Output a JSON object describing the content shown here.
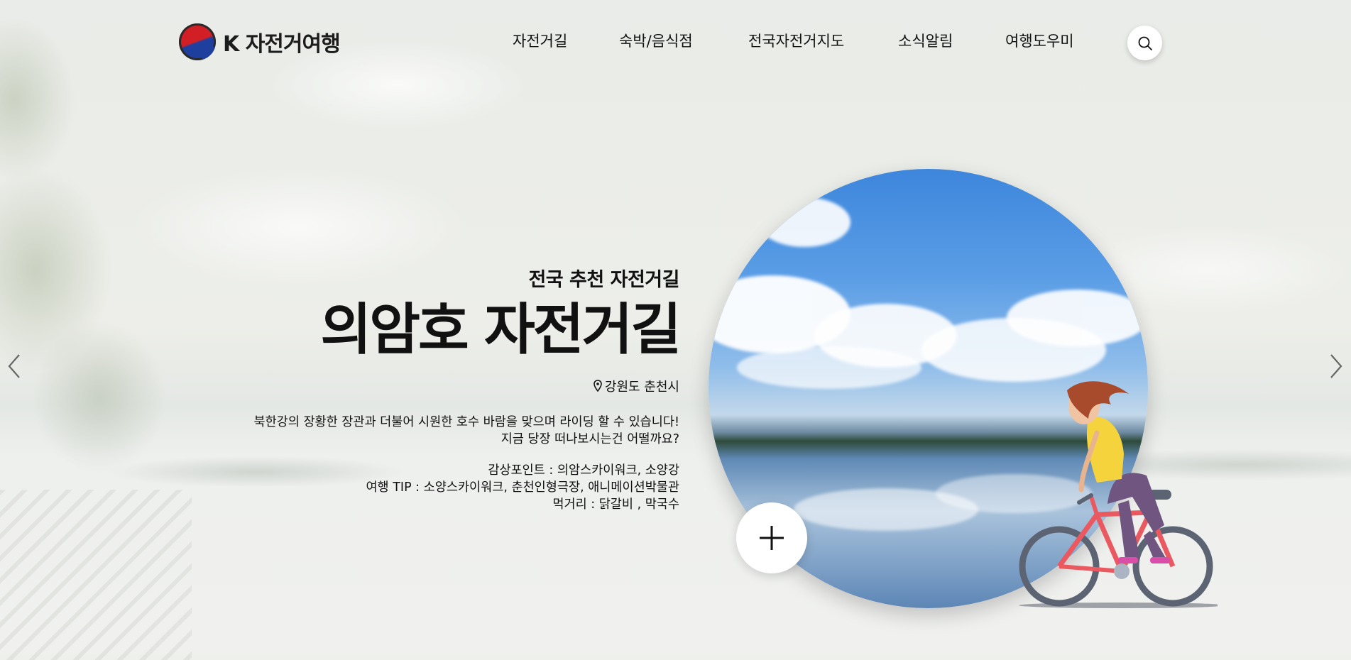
{
  "brand": {
    "logo_text": "K 자전거여행"
  },
  "nav": [
    {
      "label": "자전거길"
    },
    {
      "label": "숙박/음식점"
    },
    {
      "label": "전국자전거지도"
    },
    {
      "label": "소식알림"
    },
    {
      "label": "여행도우미"
    }
  ],
  "hero": {
    "eyebrow": "전국 추천 자전거길",
    "title": "의암호 자전거길",
    "location": "강원도 춘천시",
    "description": [
      "북한강의 장황한 장관과 더불어 시원한 호수 바람을 맞으며 라이딩 할 수 있습니다!",
      "지금 당장 떠나보시는건 어떨까요?"
    ],
    "info": [
      "감상포인트 : 의암스카이워크, 소양강",
      "여행 TIP : 소양스카이워크, 춘천인형극장, 애니메이션박물관",
      "먹거리 : 닭갈비 , 막국수"
    ]
  },
  "icons": {
    "search": "search-icon",
    "location": "map-pin-icon",
    "plus": "plus-icon",
    "prev": "chevron-left-icon",
    "next": "chevron-right-icon"
  }
}
